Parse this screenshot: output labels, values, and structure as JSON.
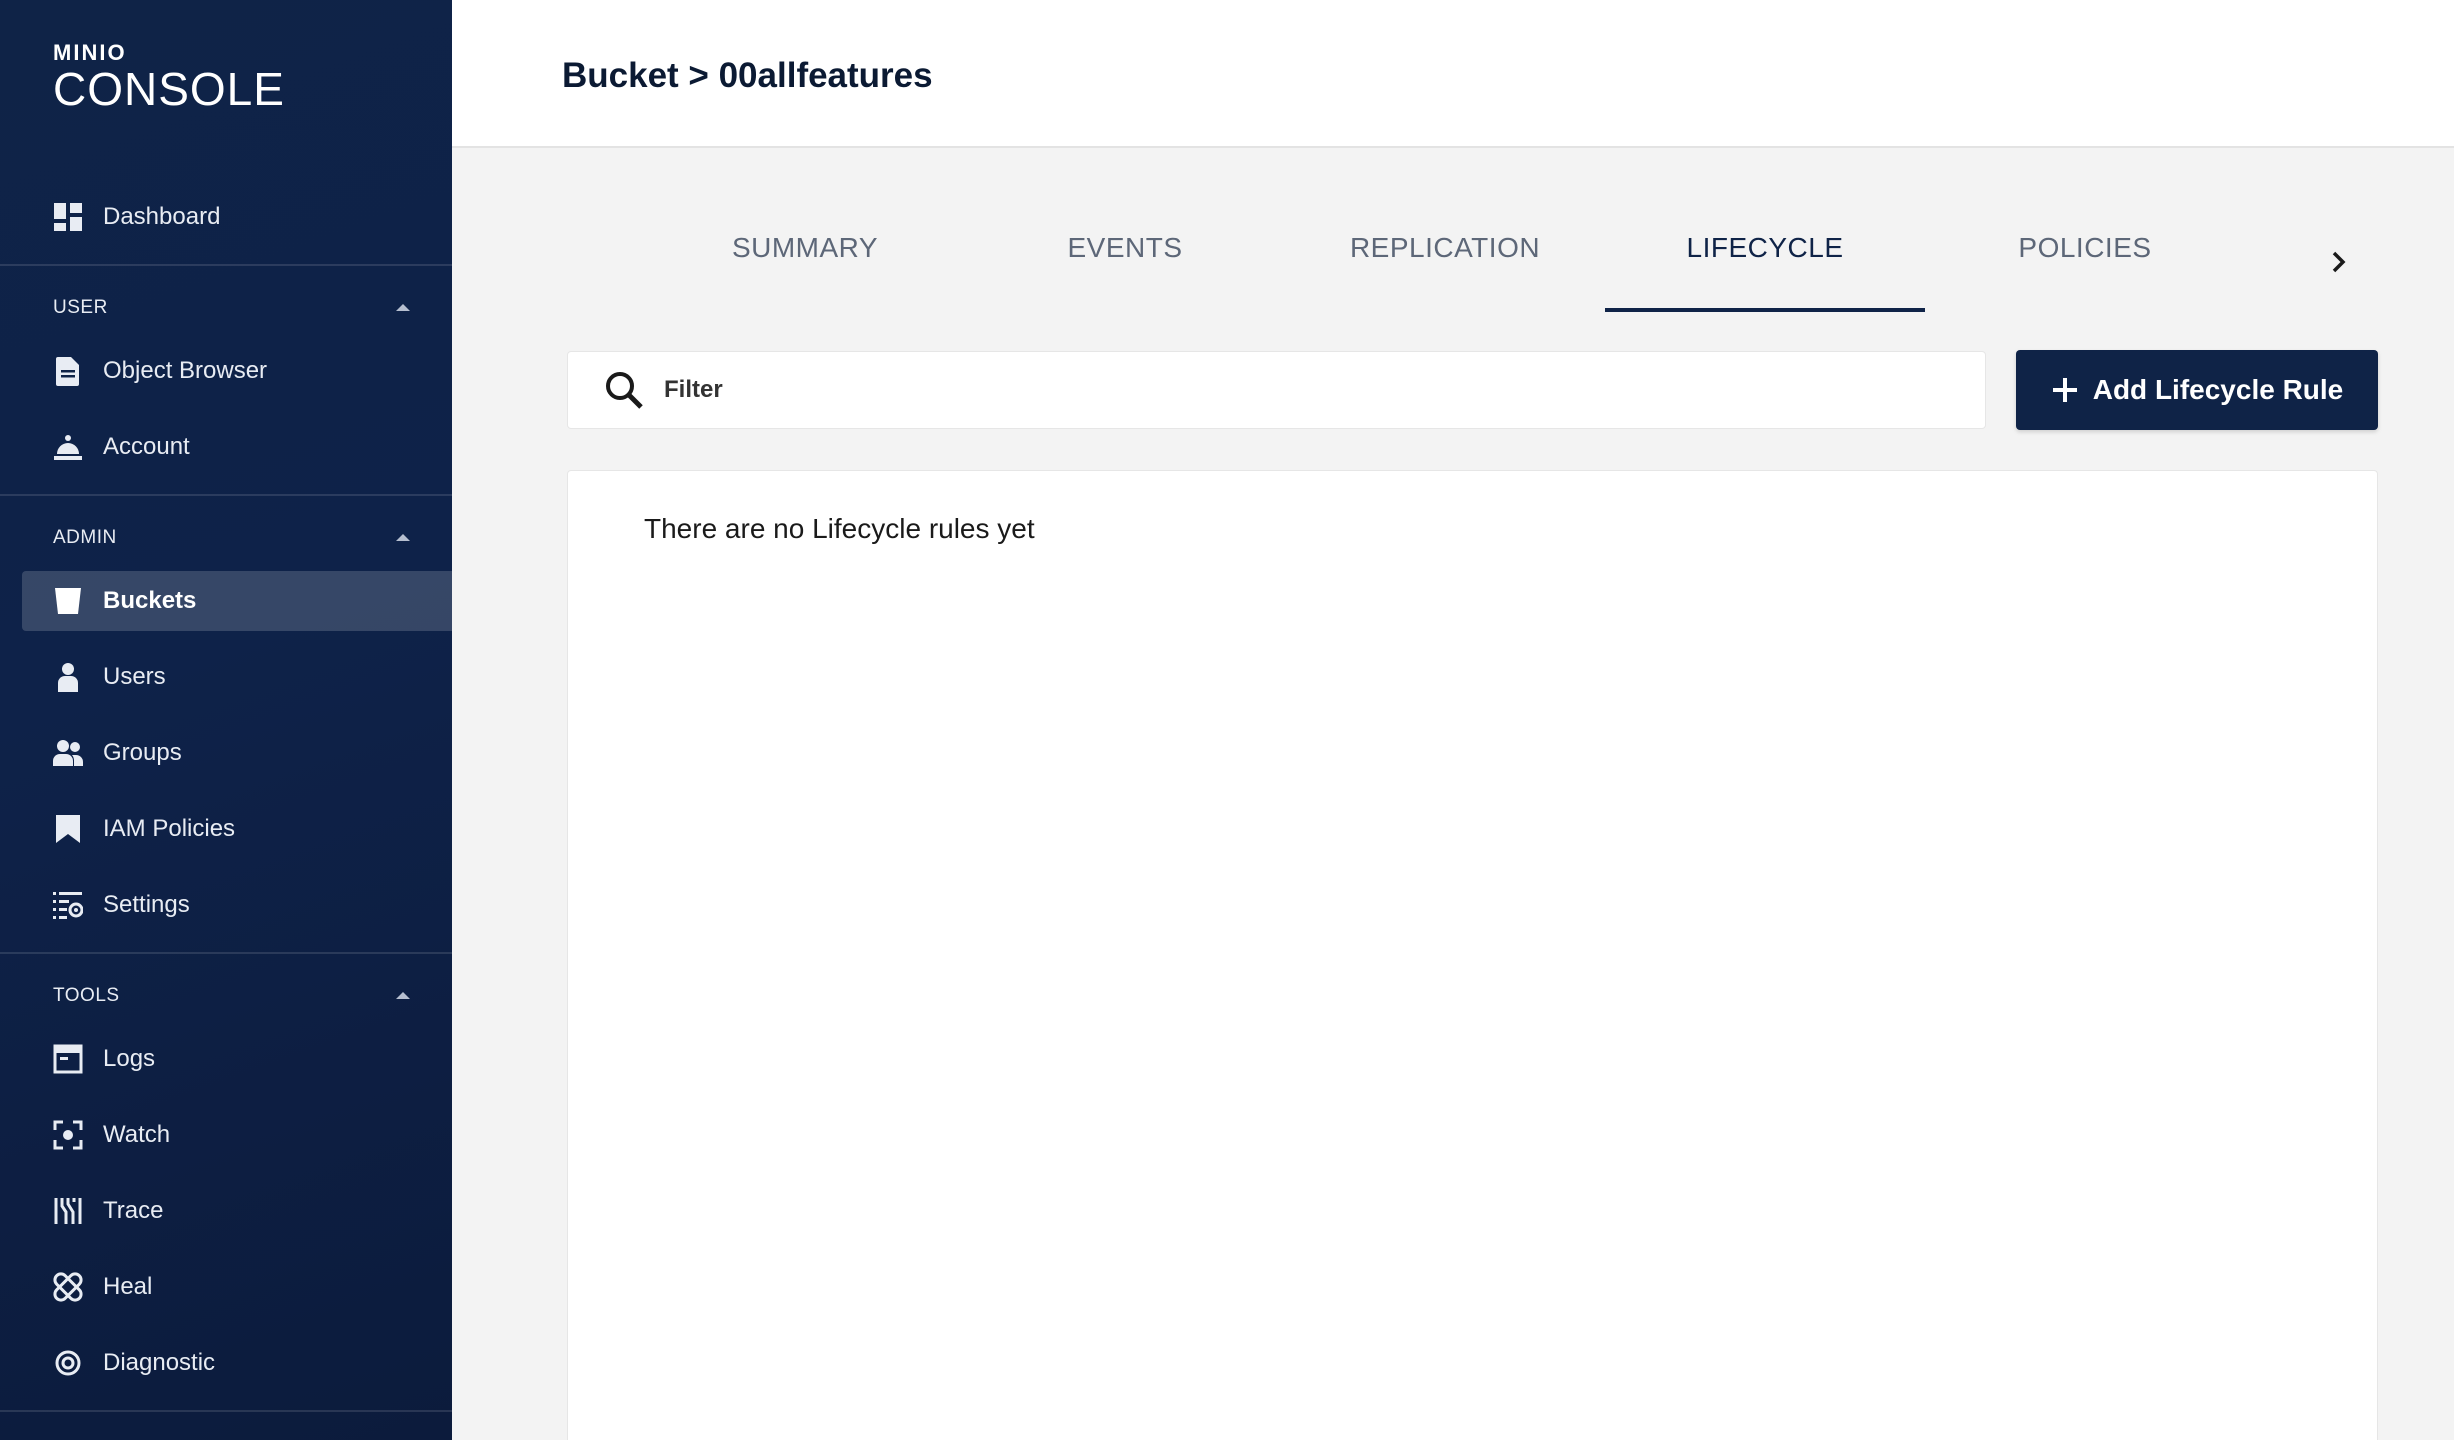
{
  "app": {
    "brand_small": "MINIO",
    "brand_big": "CONSOLE"
  },
  "sidebar": {
    "dashboard": {
      "label": "Dashboard",
      "icon": "dashboard-icon"
    },
    "sections": {
      "user": "USER",
      "admin": "ADMIN",
      "tools": "TOOLS"
    },
    "user_items": [
      {
        "label": "Object Browser",
        "icon": "document-icon"
      },
      {
        "label": "Account",
        "icon": "account-icon"
      }
    ],
    "admin_items": [
      {
        "label": "Buckets",
        "icon": "bucket-icon",
        "active": true
      },
      {
        "label": "Users",
        "icon": "user-icon"
      },
      {
        "label": "Groups",
        "icon": "groups-icon"
      },
      {
        "label": "IAM Policies",
        "icon": "bookmark-icon"
      },
      {
        "label": "Settings",
        "icon": "settings-icon"
      }
    ],
    "tools_items": [
      {
        "label": "Logs",
        "icon": "logs-icon"
      },
      {
        "label": "Watch",
        "icon": "watch-icon"
      },
      {
        "label": "Trace",
        "icon": "trace-icon"
      },
      {
        "label": "Heal",
        "icon": "heal-icon"
      },
      {
        "label": "Diagnostic",
        "icon": "diagnostic-icon"
      }
    ]
  },
  "header": {
    "title": "Bucket > 00allfeatures"
  },
  "tabs": [
    "SUMMARY",
    "EVENTS",
    "REPLICATION",
    "LIFECYCLE",
    "POLICIES"
  ],
  "active_tab": "LIFECYCLE",
  "filter": {
    "placeholder": "Filter",
    "value": ""
  },
  "add_button": {
    "label": "Add Lifecycle Rule"
  },
  "panel": {
    "empty_message": "There are no Lifecycle rules yet"
  },
  "colors": {
    "sidebar_bg": "#0f2347",
    "accent": "#0f2347",
    "page_bg": "#f3f3f3"
  }
}
